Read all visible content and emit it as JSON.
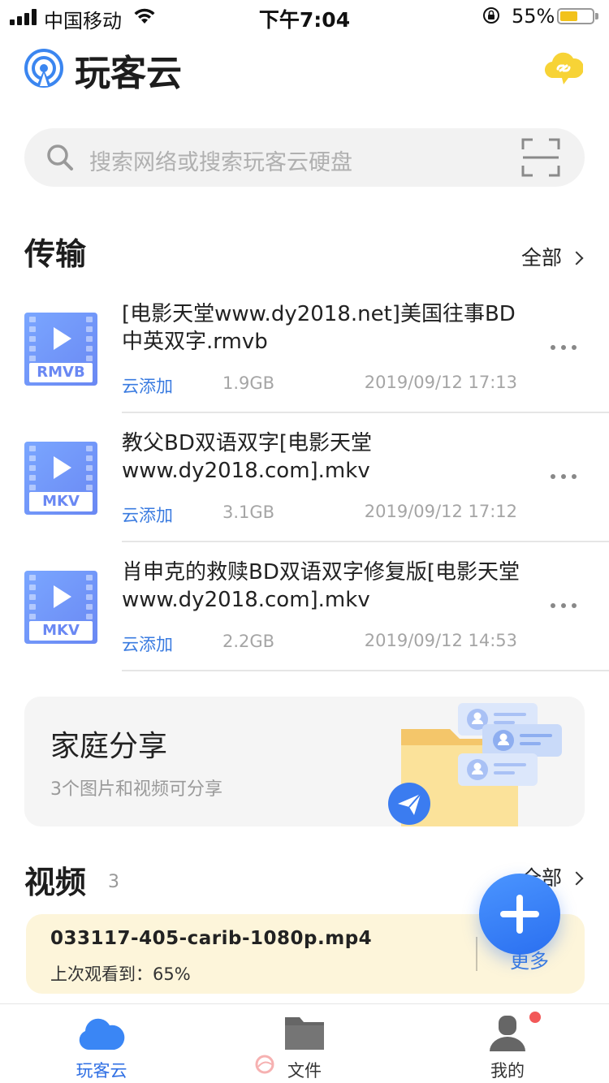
{
  "status_bar": {
    "carrier": "中国移动",
    "time": "下午7:04",
    "battery_percent_text": "55%",
    "battery_level": 0.55,
    "battery_color": "#f2c21b"
  },
  "header": {
    "app_title": "玩客云",
    "logo_icon": "broadcast-logo-icon",
    "sync_icon": "cloud-link-icon"
  },
  "search": {
    "placeholder": "搜索网络或搜索玩客云硬盘"
  },
  "transfer": {
    "title": "传输",
    "more_label": "全部",
    "items": [
      {
        "name": "[电影天堂www.dy2018.net]美国往事BD中英双字.rmvb",
        "ext": "RMVB",
        "source": "云添加",
        "size": "1.9GB",
        "date": "2019/09/12 17:13"
      },
      {
        "name": "教父BD双语双字[电影天堂www.dy2018.com].mkv",
        "ext": "MKV",
        "source": "云添加",
        "size": "3.1GB",
        "date": "2019/09/12 17:12"
      },
      {
        "name": "肖申克的救赎BD双语双字修复版[电影天堂www.dy2018.com].mkv",
        "ext": "MKV",
        "source": "云添加",
        "size": "2.2GB",
        "date": "2019/09/12 14:53"
      }
    ]
  },
  "family_share": {
    "title": "家庭分享",
    "subtitle": "3个图片和视频可分享"
  },
  "videos": {
    "title": "视频",
    "count": "3",
    "more_label": "全部",
    "recent": {
      "name": "033117-405-carib-1080p.mp4",
      "progress_text": "上次观看到：65%",
      "more_label": "更多"
    }
  },
  "tabs": [
    {
      "label": "玩客云",
      "icon": "cloud-icon",
      "active": true
    },
    {
      "label": "文件",
      "icon": "folder-icon",
      "active": false
    },
    {
      "label": "我的",
      "icon": "user-icon",
      "active": false
    }
  ],
  "colors": {
    "accent": "#2f6fe4",
    "link": "#3a7be0",
    "video_card_bg": "#fdf5da",
    "badge_red": "#f25858"
  }
}
